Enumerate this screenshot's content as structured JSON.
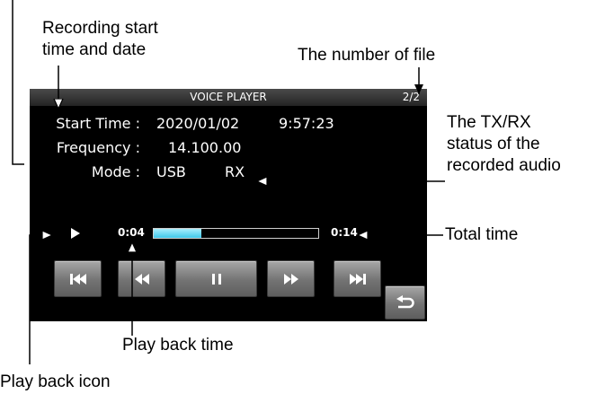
{
  "callouts": {
    "recording_start_line1": "Recording start",
    "recording_start_line2": "time and date",
    "number_of_file": "The number of file",
    "txrx_line1": "The TX/RX",
    "txrx_line2": "status of the",
    "txrx_line3": "recorded audio",
    "total_time": "Total time",
    "playback_time": "Play back time",
    "playback_icon": "Play back icon"
  },
  "screen": {
    "title": "VOICE PLAYER",
    "file_count": "2/2",
    "start_time_label": "Start Time :",
    "start_date": "2020/01/02",
    "start_time": "9:57:23",
    "frequency_label": "Frequency :",
    "frequency": "14.100.00",
    "mode_label": "Mode :",
    "mode": "USB",
    "txrx": "RX",
    "elapsed_time": "0:04",
    "total_time": "0:14",
    "progress_fraction": 0.29
  },
  "controls": {
    "buttons": [
      "skip-back-icon",
      "rewind-icon",
      "pause-icon",
      "fast-forward-icon",
      "skip-forward-icon",
      "return-icon"
    ]
  }
}
